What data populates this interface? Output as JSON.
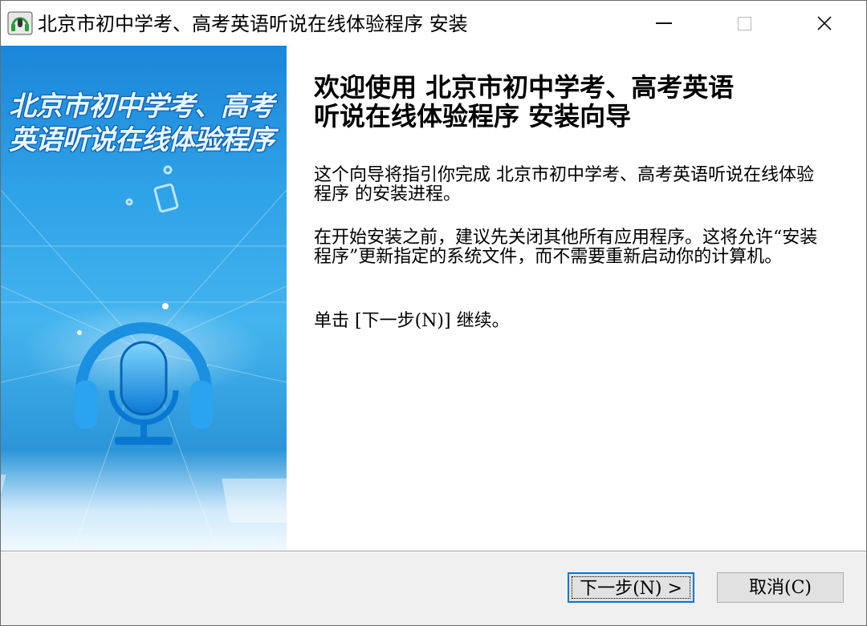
{
  "window": {
    "title": "北京市初中学考、高考英语听说在线体验程序 安装",
    "controls": {
      "minimize_icon": "minimize-icon",
      "maximize_icon": "maximize-icon",
      "close_icon": "close-icon"
    }
  },
  "banner": {
    "line1": "北京市初中学考、高考",
    "line2": "英语听说在线体验程序"
  },
  "content": {
    "heading_line1": "欢迎使用 北京市初中学考、高考英语",
    "heading_line2": "听说在线体验程序 安装向导",
    "para1": "这个向导将指引你完成 北京市初中学考、高考英语听说在线体验程序 的安装进程。",
    "para2": "在开始安装之前，建议先关闭其他所有应用程序。这将允许“安装程序”更新指定的系统文件，而不需要重新启动你的计算机。",
    "para3": "单击 [下一步(N)] 继续。"
  },
  "buttons": {
    "next_label": "下一步(N) >",
    "cancel_label": "取消(C)"
  },
  "colors": {
    "focus_border": "#0078d7",
    "banner_blue": "#2fa3e8",
    "button_bg": "#e1e1e1",
    "footer_bg": "#f0f0f0"
  }
}
